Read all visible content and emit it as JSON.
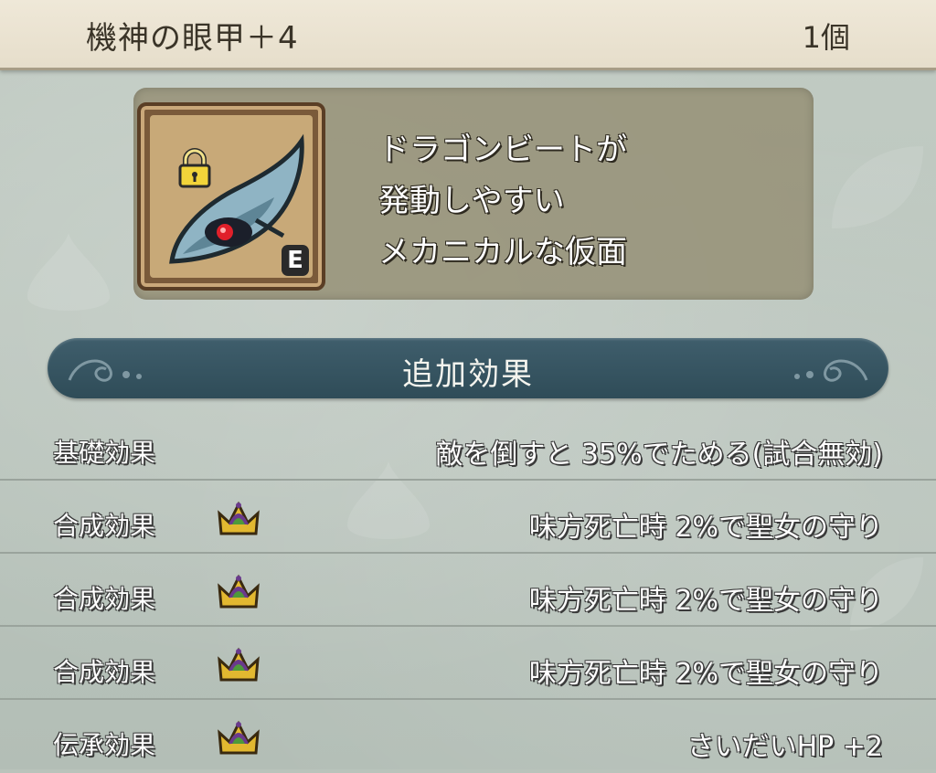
{
  "item": {
    "name": "機神の眼甲＋4",
    "count": "1個",
    "equip_badge": "E",
    "description": [
      "ドラゴンビートが",
      "発動しやすい",
      "メカニカルな仮面"
    ],
    "icon": "mechanical-mask-icon",
    "lock": "lock-icon"
  },
  "section": {
    "title": "追加効果"
  },
  "effects": [
    {
      "label": "基礎効果",
      "value": "敵を倒すと 35%でためる(試合無効)",
      "icon": null
    },
    {
      "label": "合成効果",
      "value": "味方死亡時 2%で聖女の守り",
      "icon": "crown-icon"
    },
    {
      "label": "合成効果",
      "value": "味方死亡時 2%で聖女の守り",
      "icon": "crown-icon"
    },
    {
      "label": "合成効果",
      "value": "味方死亡時 2%で聖女の守り",
      "icon": "crown-icon"
    },
    {
      "label": "伝承効果",
      "value": "さいだいHP +2",
      "icon": "crown-icon"
    }
  ],
  "colors": {
    "banner": "#2f4c58",
    "header": "#e6decb",
    "panel": "#928c70",
    "crown_gold": "#e2b830",
    "crown_purple": "#6a3a8c",
    "crown_green": "#4e9a3a"
  }
}
